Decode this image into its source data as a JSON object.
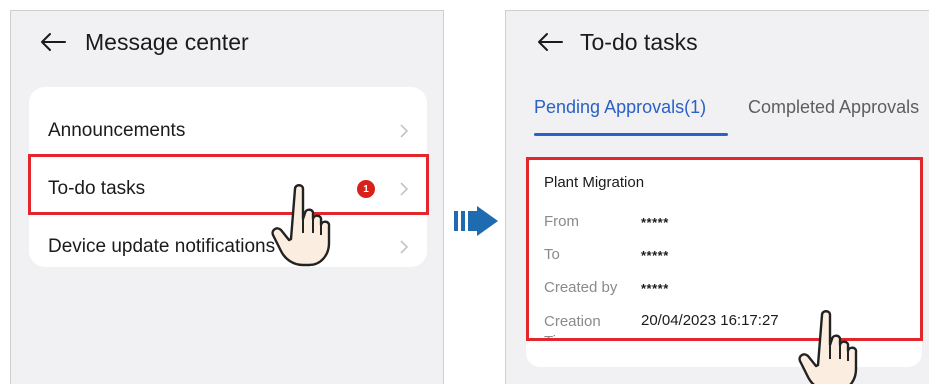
{
  "left_screen": {
    "title": "Message center",
    "items": [
      {
        "label": "Announcements"
      },
      {
        "label": "To-do tasks",
        "badge": "1"
      },
      {
        "label": "Device update notifications"
      }
    ]
  },
  "right_screen": {
    "title": "To-do tasks",
    "tabs": [
      {
        "label": "Pending Approvals(1)",
        "active": true
      },
      {
        "label": "Completed Approvals",
        "active": false
      }
    ],
    "task": {
      "title": "Plant Migration",
      "fields": [
        {
          "key": "From",
          "value": "*****"
        },
        {
          "key": "To",
          "value": "*****"
        },
        {
          "key": "Created by",
          "value": "*****"
        },
        {
          "key": "Creation Time",
          "value": "20/04/2023 16:17:27"
        }
      ]
    }
  },
  "colors": {
    "highlight": "#e3262b",
    "accent": "#2a60c7",
    "badge": "#d8211b",
    "flow_arrow": "#1e6bb0"
  },
  "icons": [
    "back-arrow-icon",
    "chevron-right-icon",
    "pointing-hand-icon",
    "flow-arrow-icon"
  ]
}
